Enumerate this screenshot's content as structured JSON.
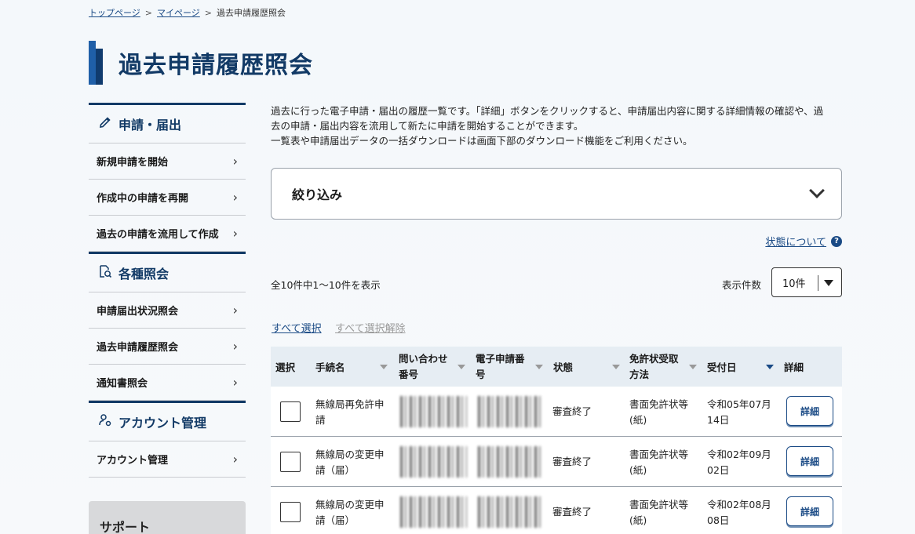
{
  "breadcrumb": {
    "top": "トップページ",
    "my": "マイページ",
    "current": "過去申請履歴照会",
    "sep": ">"
  },
  "page_title": "過去申請履歴照会",
  "sidebar": {
    "sections": [
      {
        "title": "申請・届出",
        "icon": "pencil-icon",
        "items": [
          "新規申請を開始",
          "作成中の申請を再開",
          "過去の申請を流用して作成"
        ]
      },
      {
        "title": "各種照会",
        "icon": "document-search-icon",
        "items": [
          "申請届出状況照会",
          "過去申請履歴照会",
          "通知書照会"
        ]
      },
      {
        "title": "アカウント管理",
        "icon": "user-gear-icon",
        "items": [
          "アカウント管理"
        ]
      }
    ],
    "support_title": "サポート"
  },
  "intro": [
    "過去に行った電子申請・届出の履歴一覧です。「詳細」ボタンをクリックすると、申請届出内容に関する詳細情報の確認や、過",
    "去の申請・届出内容を流用して新たに申請を開始することができます。",
    "一覧表や申請届出データの一括ダウンロードは画面下部のダウンロード機能をご利用ください。"
  ],
  "filter": {
    "title": "絞り込み"
  },
  "status_link": {
    "label": "状態について",
    "icon": "help-icon",
    "icon_glyph": "?"
  },
  "count_text": "全10件中1～10件を表示",
  "per_page": {
    "label": "表示件数",
    "value": "10件"
  },
  "select_all": "すべて選択",
  "deselect_all": "すべて選択解除",
  "table": {
    "headers": {
      "select": "選択",
      "procedure": "手続名",
      "inquiry_no_1": "問い合わせ",
      "inquiry_no_2": "番号",
      "app_no_1": "電子申請番",
      "app_no_2": "号",
      "status": "状態",
      "receipt_1": "免許状受取",
      "receipt_2": "方法",
      "date": "受付日",
      "detail": "詳細"
    },
    "rows": [
      {
        "procedure_1": "無線局再免許申",
        "procedure_2": "請",
        "status": "審査終了",
        "receipt_1": "書面免許状等",
        "receipt_2": "(紙)",
        "date_1": "令和05年07月",
        "date_2": "14日",
        "detail_label": "詳細"
      },
      {
        "procedure_1": "無線局の変更申",
        "procedure_2": "請（届）",
        "status": "審査終了",
        "receipt_1": "書面免許状等",
        "receipt_2": "(紙)",
        "date_1": "令和02年09月",
        "date_2": "02日",
        "detail_label": "詳細"
      },
      {
        "procedure_1": "無線局の変更申",
        "procedure_2": "請（届）",
        "status": "審査終了",
        "receipt_1": "書面免許状等",
        "receipt_2": "(紙)",
        "date_1": "令和02年08月",
        "date_2": "08日",
        "detail_label": "詳細"
      }
    ]
  },
  "colors": {
    "navy": "#123a66",
    "link": "#1a4a85",
    "table_header_bg": "#e6edf3"
  }
}
